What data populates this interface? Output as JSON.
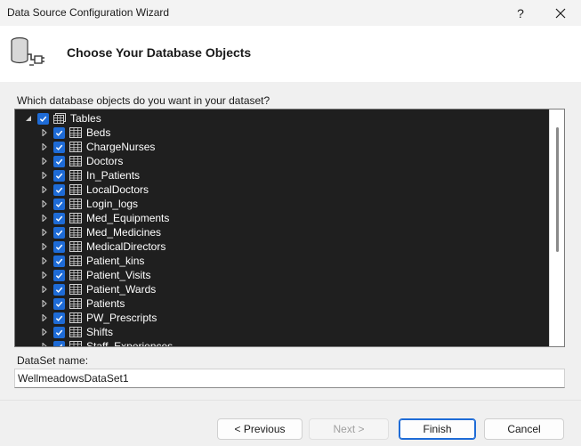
{
  "window": {
    "title": "Data Source Configuration Wizard",
    "help_glyph": "?"
  },
  "header": {
    "title": "Choose Your Database Objects",
    "icon": "database-connection-icon"
  },
  "question": "Which database objects do you want in your dataset?",
  "tree": {
    "root": {
      "label": "Tables",
      "expanded": true,
      "checked": true
    },
    "items": [
      {
        "label": "Beds",
        "checked": true
      },
      {
        "label": "ChargeNurses",
        "checked": true
      },
      {
        "label": "Doctors",
        "checked": true
      },
      {
        "label": "In_Patients",
        "checked": true
      },
      {
        "label": "LocalDoctors",
        "checked": true
      },
      {
        "label": "Login_logs",
        "checked": true
      },
      {
        "label": "Med_Equipments",
        "checked": true
      },
      {
        "label": "Med_Medicines",
        "checked": true
      },
      {
        "label": "MedicalDirectors",
        "checked": true
      },
      {
        "label": "Patient_kins",
        "checked": true
      },
      {
        "label": "Patient_Visits",
        "checked": true
      },
      {
        "label": "Patient_Wards",
        "checked": true
      },
      {
        "label": "Patients",
        "checked": true
      },
      {
        "label": "PW_Prescripts",
        "checked": true
      },
      {
        "label": "Shifts",
        "checked": true
      },
      {
        "label": "Staff_Experiences",
        "checked": true
      }
    ]
  },
  "dataset": {
    "label": "DataSet name:",
    "value": "WellmeadowsDataSet1"
  },
  "buttons": {
    "previous": "< Previous",
    "next": "Next >",
    "finish": "Finish",
    "cancel": "Cancel"
  },
  "colors": {
    "tree_background": "#1f1f1f",
    "checkbox_accent": "#1e6bd6",
    "header_background": "#ffffff",
    "window_background": "#f0f0f0"
  }
}
